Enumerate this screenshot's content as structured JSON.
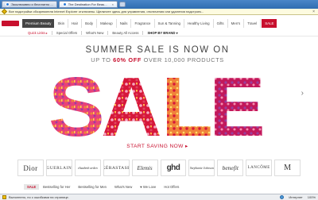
{
  "browser": {
    "tabs": [
      {
        "label": "Эксклюзивно и бесплатно ...",
        "active": false
      },
      {
        "label": "The Destination For Beau...",
        "active": true
      }
    ],
    "infobar_text": "Все надстройки обозревателя Internet Explorer отключены. Щелкните здесь для управления, отключения или удаления надстроек...",
    "status_text": "Выполнено, но с ошибками на странице.",
    "status_zone": "Интернет",
    "zoom": "100%"
  },
  "topnav": {
    "items": [
      "Premium Beauty",
      "Skin",
      "Hair",
      "Body",
      "Makeup",
      "Nails",
      "Fragrance",
      "Sun & Tanning",
      "Healthy Living",
      "Gifts",
      "Men's",
      "Travel",
      "SALE"
    ]
  },
  "subnav": {
    "items": [
      "Quick Links ▸",
      "Special Offers",
      "What's New",
      "Beauty All Access",
      "SHOP BY BRAND ▾"
    ]
  },
  "hero": {
    "title": "SUMMER SALE IS NOW ON",
    "sub_prefix": "UP TO ",
    "sub_highlight": "60% OFF",
    "sub_suffix": " OVER 10,000 PRODUCTS",
    "art_word": "SALE",
    "cta": "START SAVING NOW ▸"
  },
  "brands": [
    "Dior",
    "GUERLAIN",
    "elizabeth arden",
    "KÉRASTASE",
    "Elemis",
    "ghd",
    "Stephanie Johnson",
    "benefit",
    "LANCÔME",
    "M"
  ],
  "bottomtabs": [
    "SALE",
    "Bestselling for Her",
    "Bestselling for Men",
    "What's New",
    "♥ We Love",
    "Hot Offers"
  ],
  "colors": {
    "accent": "#c8102e",
    "sale_pink": "#e8417a",
    "sale_red": "#d6173a",
    "sale_orange": "#f0833a",
    "sale_purple": "#9a3f9e"
  }
}
